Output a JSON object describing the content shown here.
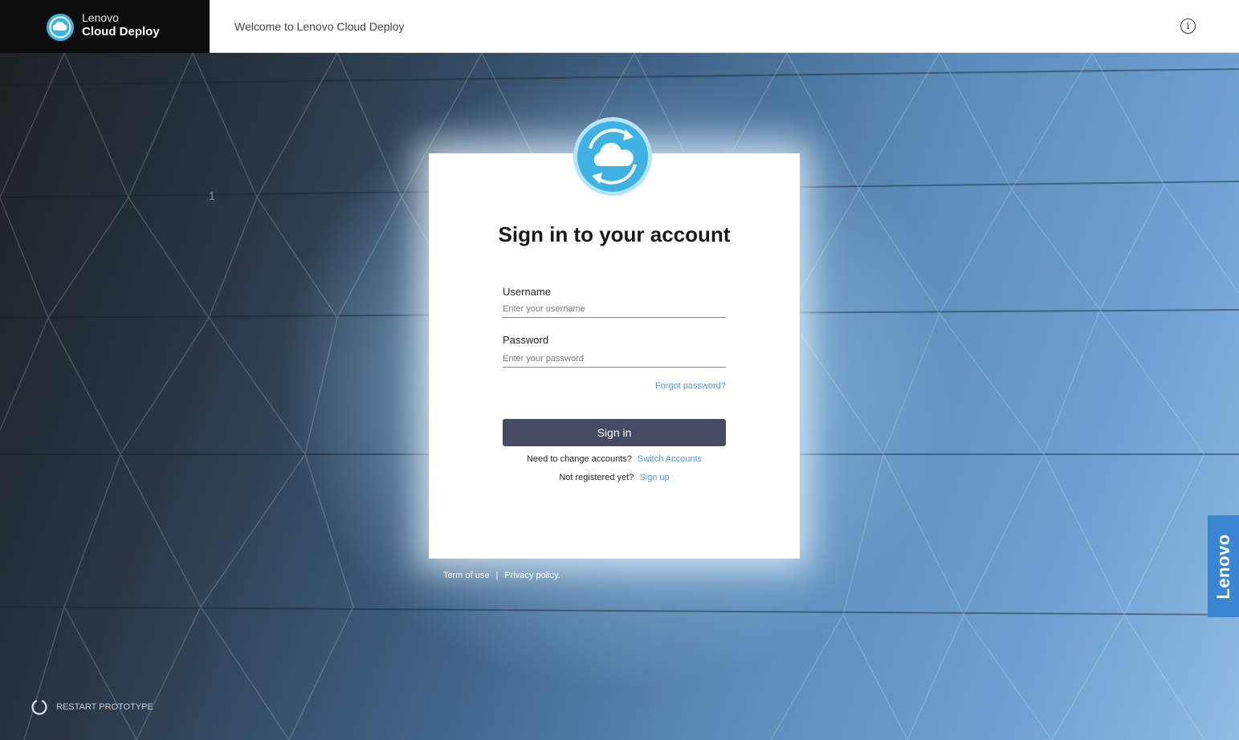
{
  "header": {
    "brand_line1": "Lenovo",
    "brand_line2": "Cloud Deploy",
    "welcome": "Welcome to Lenovo Cloud Deploy",
    "info_glyph": "i"
  },
  "page_number": "1",
  "login": {
    "title": "Sign in to your account",
    "username_label": "Username",
    "username_placeholder": "Enter your username",
    "password_label": "Password",
    "password_placeholder": "Enter your password",
    "forgot": "Forgot password?",
    "signin": "Sign in",
    "switch_prompt": "Need to change accounts?",
    "switch_link": "Switch Accounts",
    "register_prompt": "Not registered yet?",
    "register_link": "Sign up"
  },
  "footer": {
    "terms": "Term of use",
    "separator": "|",
    "privacy": "Privacy policy."
  },
  "restart": "RESTART PROTOTYPE",
  "side_tab": "Lenovo",
  "colors": {
    "button": "#474a63",
    "link": "#4a9ad6",
    "side_tab": "#3b86d3",
    "logo": "#3eb3e3"
  },
  "icons": {
    "brand": "cloud-sync-icon",
    "info": "info-icon",
    "restart": "refresh-icon"
  }
}
